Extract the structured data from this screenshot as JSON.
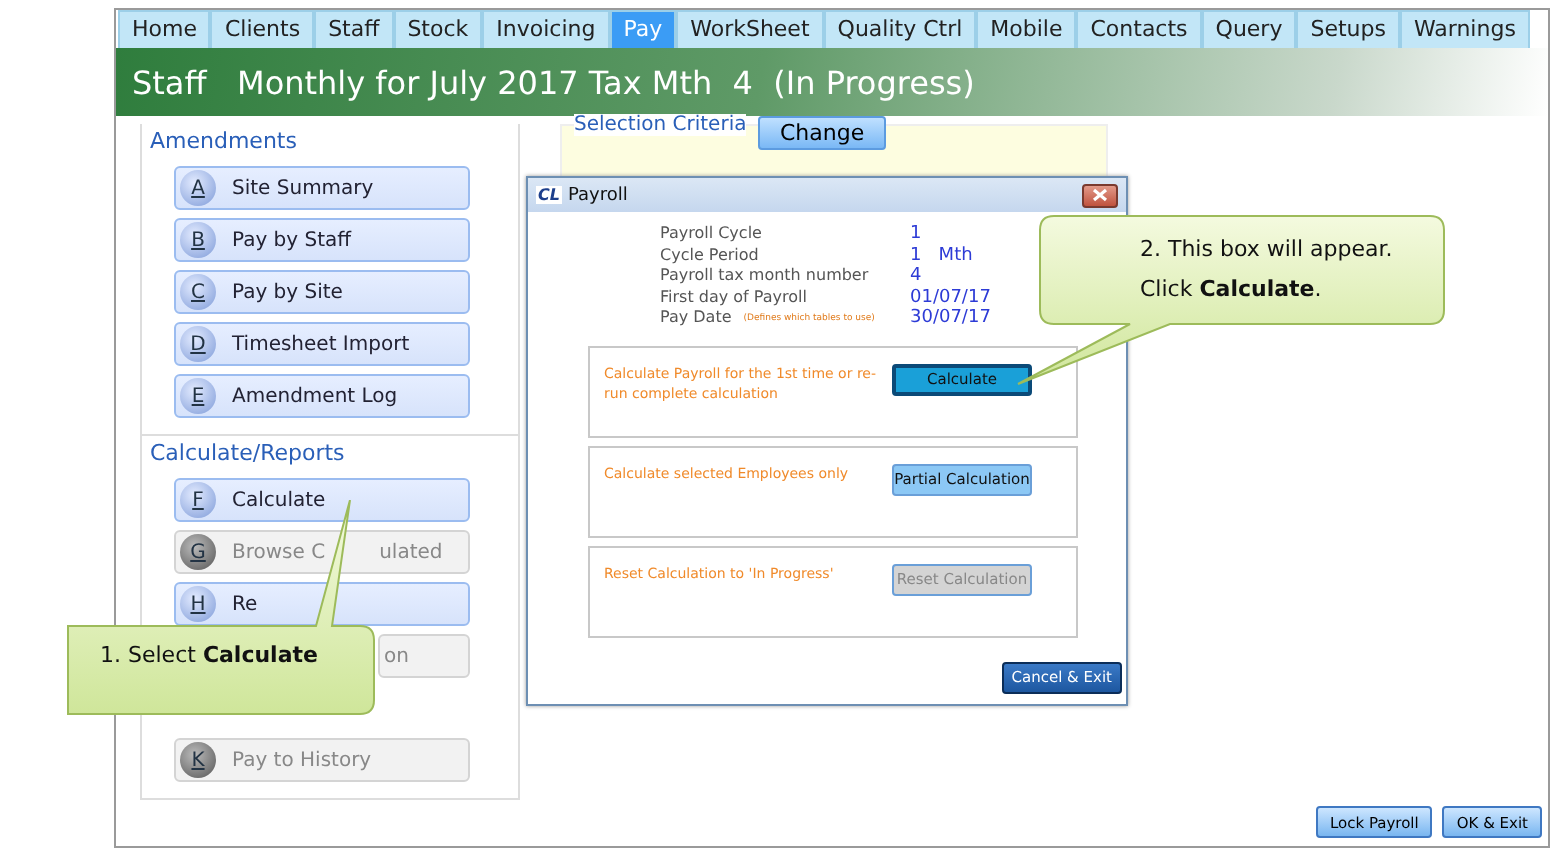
{
  "tabs": [
    {
      "label": "Home",
      "selected": false
    },
    {
      "label": "Clients",
      "selected": false
    },
    {
      "label": "Staff",
      "selected": false
    },
    {
      "label": "Stock",
      "selected": false
    },
    {
      "label": "Invoicing",
      "selected": false
    },
    {
      "label": "Pay",
      "selected": true
    },
    {
      "label": "WorkSheet",
      "selected": false
    },
    {
      "label": "Quality Ctrl",
      "selected": false
    },
    {
      "label": "Mobile",
      "selected": false
    },
    {
      "label": "Contacts",
      "selected": false
    },
    {
      "label": "Query",
      "selected": false
    },
    {
      "label": "Setups",
      "selected": false
    },
    {
      "label": "Warnings",
      "selected": false
    }
  ],
  "header": {
    "title": "Staff   Monthly for July 2017 Tax Mth  4  (In Progress)"
  },
  "groups": [
    {
      "title": "Amendments",
      "buttons": [
        {
          "letter": "A",
          "label": "Site Summary",
          "disabled": false
        },
        {
          "letter": "B",
          "label": "Pay by Staff",
          "disabled": false
        },
        {
          "letter": "C",
          "label": "Pay by Site",
          "disabled": false
        },
        {
          "letter": "D",
          "label": "Timesheet Import",
          "disabled": false
        },
        {
          "letter": "E",
          "label": "Amendment Log",
          "disabled": false
        }
      ]
    },
    {
      "title": "Calculate/Reports",
      "buttons": [
        {
          "letter": "F",
          "label": "Calculate",
          "disabled": false
        },
        {
          "letter": "G",
          "label": "Browse C",
          "label_2": "ulated",
          "disabled": true
        },
        {
          "letter": "H",
          "label": "Re",
          "disabled": false
        },
        {
          "label": "on",
          "disabled": true,
          "kind": "covered"
        },
        {
          "kind": "gap"
        },
        {
          "letter": "K",
          "label": "Pay to History",
          "disabled": true
        }
      ]
    }
  ],
  "selection": {
    "title": "Selection Criteria",
    "button": "Change"
  },
  "dialog": {
    "logo": "CL",
    "title": "Payroll",
    "info": [
      {
        "label": "Payroll Cycle",
        "value": "1"
      },
      {
        "label": "Cycle Period",
        "value": "1   Mth"
      },
      {
        "label": "Payroll tax month number",
        "value": "4"
      },
      {
        "label": "First day of Payroll",
        "value": "01/07/17"
      },
      {
        "label": "Pay Date",
        "note": "(Defines which tables to use)",
        "value": "30/07/17"
      }
    ],
    "sections": [
      {
        "text": "Calculate Payroll for the 1st time or re-run complete calculation",
        "button": "Calculate",
        "kind": "focused"
      },
      {
        "text": "Calculate selected Employees only",
        "button": "Partial Calculation",
        "kind": "normal"
      },
      {
        "text": "Reset Calculation to 'In Progress'",
        "button": "Reset Calculation",
        "kind": "disabled"
      }
    ],
    "exit_button": "Cancel & Exit"
  },
  "footer_buttons": [
    "Lock Payroll",
    "OK & Exit"
  ],
  "callouts": [
    {
      "text": "1. Select **Calculate**",
      "kind": "left"
    },
    {
      "text": "2. This box will appear. Click **Calculate**.",
      "kind": "right"
    }
  ]
}
